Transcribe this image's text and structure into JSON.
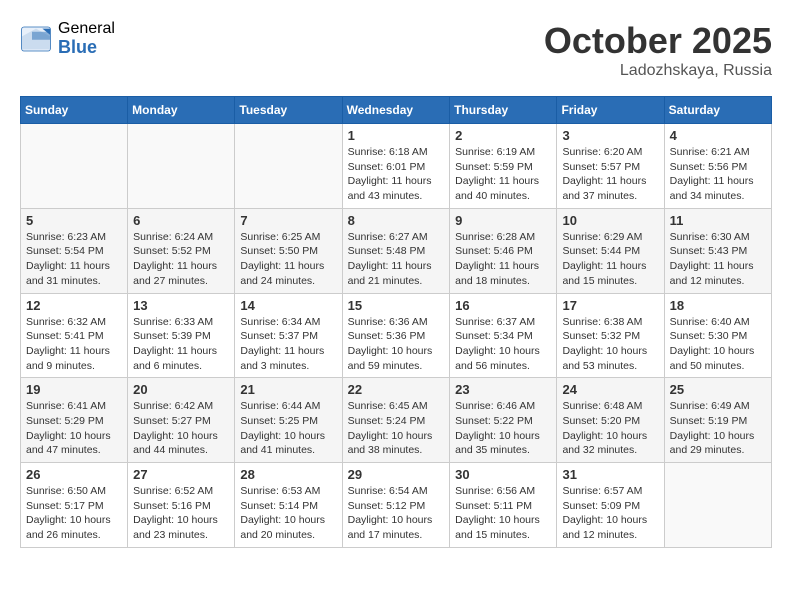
{
  "header": {
    "logo_general": "General",
    "logo_blue": "Blue",
    "title": "October 2025",
    "location": "Ladozhskaya, Russia"
  },
  "days_of_week": [
    "Sunday",
    "Monday",
    "Tuesday",
    "Wednesday",
    "Thursday",
    "Friday",
    "Saturday"
  ],
  "weeks": [
    [
      {
        "day": "",
        "info": ""
      },
      {
        "day": "",
        "info": ""
      },
      {
        "day": "",
        "info": ""
      },
      {
        "day": "1",
        "info": "Sunrise: 6:18 AM\nSunset: 6:01 PM\nDaylight: 11 hours\nand 43 minutes."
      },
      {
        "day": "2",
        "info": "Sunrise: 6:19 AM\nSunset: 5:59 PM\nDaylight: 11 hours\nand 40 minutes."
      },
      {
        "day": "3",
        "info": "Sunrise: 6:20 AM\nSunset: 5:57 PM\nDaylight: 11 hours\nand 37 minutes."
      },
      {
        "day": "4",
        "info": "Sunrise: 6:21 AM\nSunset: 5:56 PM\nDaylight: 11 hours\nand 34 minutes."
      }
    ],
    [
      {
        "day": "5",
        "info": "Sunrise: 6:23 AM\nSunset: 5:54 PM\nDaylight: 11 hours\nand 31 minutes."
      },
      {
        "day": "6",
        "info": "Sunrise: 6:24 AM\nSunset: 5:52 PM\nDaylight: 11 hours\nand 27 minutes."
      },
      {
        "day": "7",
        "info": "Sunrise: 6:25 AM\nSunset: 5:50 PM\nDaylight: 11 hours\nand 24 minutes."
      },
      {
        "day": "8",
        "info": "Sunrise: 6:27 AM\nSunset: 5:48 PM\nDaylight: 11 hours\nand 21 minutes."
      },
      {
        "day": "9",
        "info": "Sunrise: 6:28 AM\nSunset: 5:46 PM\nDaylight: 11 hours\nand 18 minutes."
      },
      {
        "day": "10",
        "info": "Sunrise: 6:29 AM\nSunset: 5:44 PM\nDaylight: 11 hours\nand 15 minutes."
      },
      {
        "day": "11",
        "info": "Sunrise: 6:30 AM\nSunset: 5:43 PM\nDaylight: 11 hours\nand 12 minutes."
      }
    ],
    [
      {
        "day": "12",
        "info": "Sunrise: 6:32 AM\nSunset: 5:41 PM\nDaylight: 11 hours\nand 9 minutes."
      },
      {
        "day": "13",
        "info": "Sunrise: 6:33 AM\nSunset: 5:39 PM\nDaylight: 11 hours\nand 6 minutes."
      },
      {
        "day": "14",
        "info": "Sunrise: 6:34 AM\nSunset: 5:37 PM\nDaylight: 11 hours\nand 3 minutes."
      },
      {
        "day": "15",
        "info": "Sunrise: 6:36 AM\nSunset: 5:36 PM\nDaylight: 10 hours\nand 59 minutes."
      },
      {
        "day": "16",
        "info": "Sunrise: 6:37 AM\nSunset: 5:34 PM\nDaylight: 10 hours\nand 56 minutes."
      },
      {
        "day": "17",
        "info": "Sunrise: 6:38 AM\nSunset: 5:32 PM\nDaylight: 10 hours\nand 53 minutes."
      },
      {
        "day": "18",
        "info": "Sunrise: 6:40 AM\nSunset: 5:30 PM\nDaylight: 10 hours\nand 50 minutes."
      }
    ],
    [
      {
        "day": "19",
        "info": "Sunrise: 6:41 AM\nSunset: 5:29 PM\nDaylight: 10 hours\nand 47 minutes."
      },
      {
        "day": "20",
        "info": "Sunrise: 6:42 AM\nSunset: 5:27 PM\nDaylight: 10 hours\nand 44 minutes."
      },
      {
        "day": "21",
        "info": "Sunrise: 6:44 AM\nSunset: 5:25 PM\nDaylight: 10 hours\nand 41 minutes."
      },
      {
        "day": "22",
        "info": "Sunrise: 6:45 AM\nSunset: 5:24 PM\nDaylight: 10 hours\nand 38 minutes."
      },
      {
        "day": "23",
        "info": "Sunrise: 6:46 AM\nSunset: 5:22 PM\nDaylight: 10 hours\nand 35 minutes."
      },
      {
        "day": "24",
        "info": "Sunrise: 6:48 AM\nSunset: 5:20 PM\nDaylight: 10 hours\nand 32 minutes."
      },
      {
        "day": "25",
        "info": "Sunrise: 6:49 AM\nSunset: 5:19 PM\nDaylight: 10 hours\nand 29 minutes."
      }
    ],
    [
      {
        "day": "26",
        "info": "Sunrise: 6:50 AM\nSunset: 5:17 PM\nDaylight: 10 hours\nand 26 minutes."
      },
      {
        "day": "27",
        "info": "Sunrise: 6:52 AM\nSunset: 5:16 PM\nDaylight: 10 hours\nand 23 minutes."
      },
      {
        "day": "28",
        "info": "Sunrise: 6:53 AM\nSunset: 5:14 PM\nDaylight: 10 hours\nand 20 minutes."
      },
      {
        "day": "29",
        "info": "Sunrise: 6:54 AM\nSunset: 5:12 PM\nDaylight: 10 hours\nand 17 minutes."
      },
      {
        "day": "30",
        "info": "Sunrise: 6:56 AM\nSunset: 5:11 PM\nDaylight: 10 hours\nand 15 minutes."
      },
      {
        "day": "31",
        "info": "Sunrise: 6:57 AM\nSunset: 5:09 PM\nDaylight: 10 hours\nand 12 minutes."
      },
      {
        "day": "",
        "info": ""
      }
    ]
  ]
}
